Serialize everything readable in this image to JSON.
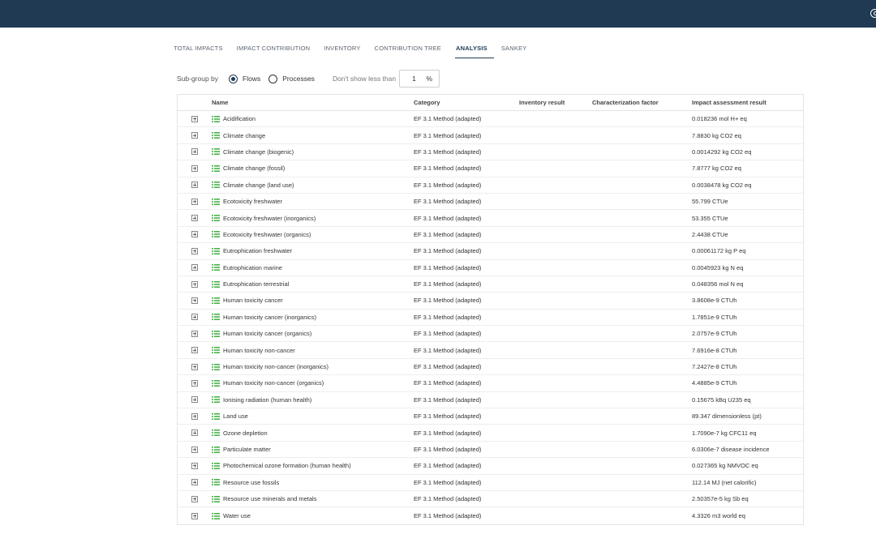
{
  "tabs": [
    {
      "label": "TOTAL IMPACTS",
      "active": false
    },
    {
      "label": "IMPACT CONTRIBUTION",
      "active": false
    },
    {
      "label": "INVENTORY",
      "active": false
    },
    {
      "label": "CONTRIBUTION TREE",
      "active": false
    },
    {
      "label": "ANALYSIS",
      "active": true
    },
    {
      "label": "SANKEY",
      "active": false
    }
  ],
  "controls": {
    "subgroup_label": "Sub-group by",
    "option_flows": "Flows",
    "option_processes": "Processes",
    "selected": "flows",
    "dont_show_label": "Don't show less than",
    "threshold_value": "1",
    "threshold_unit": "%"
  },
  "table": {
    "headers": {
      "name": "Name",
      "category": "Category",
      "inventory": "Inventory result",
      "characterization": "Characterization factor",
      "impact": "Impact assessment result"
    },
    "rows": [
      {
        "name": "Acidification",
        "category": "EF 3.1 Method (adapted)",
        "inventory": "",
        "characterization": "",
        "impact": "0.018236 mol H+ eq"
      },
      {
        "name": "Climate change",
        "category": "EF 3.1 Method (adapted)",
        "inventory": "",
        "characterization": "",
        "impact": "7.8830 kg CO2 eq"
      },
      {
        "name": "Climate change (biogenic)",
        "category": "EF 3.1 Method (adapted)",
        "inventory": "",
        "characterization": "",
        "impact": "0.0014292 kg CO2 eq"
      },
      {
        "name": "Climate change (fossil)",
        "category": "EF 3.1 Method (adapted)",
        "inventory": "",
        "characterization": "",
        "impact": "7.8777 kg CO2 eq"
      },
      {
        "name": "Climate change (land use)",
        "category": "EF 3.1 Method (adapted)",
        "inventory": "",
        "characterization": "",
        "impact": "0.0038478 kg CO2 eq"
      },
      {
        "name": "Ecotoxicity freshwater",
        "category": "EF 3.1 Method (adapted)",
        "inventory": "",
        "characterization": "",
        "impact": "55.799 CTUe"
      },
      {
        "name": "Ecotoxicity freshwater (inorganics)",
        "category": "EF 3.1 Method (adapted)",
        "inventory": "",
        "characterization": "",
        "impact": "53.355 CTUe"
      },
      {
        "name": "Ecotoxicity freshwater (organics)",
        "category": "EF 3.1 Method (adapted)",
        "inventory": "",
        "characterization": "",
        "impact": "2.4438 CTUe"
      },
      {
        "name": "Eutrophication freshwater",
        "category": "EF 3.1 Method (adapted)",
        "inventory": "",
        "characterization": "",
        "impact": "0.00061172 kg P eq"
      },
      {
        "name": "Eutrophication marine",
        "category": "EF 3.1 Method (adapted)",
        "inventory": "",
        "characterization": "",
        "impact": "0.0045923 kg N eq"
      },
      {
        "name": "Eutrophication terrestrial",
        "category": "EF 3.1 Method (adapted)",
        "inventory": "",
        "characterization": "",
        "impact": "0.048356 mol N eq"
      },
      {
        "name": "Human toxicity cancer",
        "category": "EF 3.1 Method (adapted)",
        "inventory": "",
        "characterization": "",
        "impact": "3.8608e-9 CTUh"
      },
      {
        "name": "Human toxicity cancer (inorganics)",
        "category": "EF 3.1 Method (adapted)",
        "inventory": "",
        "characterization": "",
        "impact": "1.7851e-9 CTUh"
      },
      {
        "name": "Human toxicity cancer (organics)",
        "category": "EF 3.1 Method (adapted)",
        "inventory": "",
        "characterization": "",
        "impact": "2.0757e-9 CTUh"
      },
      {
        "name": "Human toxicity non-cancer",
        "category": "EF 3.1 Method (adapted)",
        "inventory": "",
        "characterization": "",
        "impact": "7.6916e-8 CTUh"
      },
      {
        "name": "Human toxicity non-cancer (inorganics)",
        "category": "EF 3.1 Method (adapted)",
        "inventory": "",
        "characterization": "",
        "impact": "7.2427e-8 CTUh"
      },
      {
        "name": "Human toxicity non-cancer (organics)",
        "category": "EF 3.1 Method (adapted)",
        "inventory": "",
        "characterization": "",
        "impact": "4.4885e-9 CTUh"
      },
      {
        "name": "Ionising radiation (human health)",
        "category": "EF 3.1 Method (adapted)",
        "inventory": "",
        "characterization": "",
        "impact": "0.15675 kBq U235 eq"
      },
      {
        "name": "Land use",
        "category": "EF 3.1 Method (adapted)",
        "inventory": "",
        "characterization": "",
        "impact": "89.347 dimensionless (pt)"
      },
      {
        "name": "Ozone depletion",
        "category": "EF 3.1 Method (adapted)",
        "inventory": "",
        "characterization": "",
        "impact": "1.7090e-7 kg CFC11 eq"
      },
      {
        "name": "Particulate matter",
        "category": "EF 3.1 Method (adapted)",
        "inventory": "",
        "characterization": "",
        "impact": "6.0306e-7 disease incidence"
      },
      {
        "name": "Photochemical ozone formation (human health)",
        "category": "EF 3.1 Method (adapted)",
        "inventory": "",
        "characterization": "",
        "impact": "0.027365 kg NMVOC eq"
      },
      {
        "name": "Resource use fossils",
        "category": "EF 3.1 Method (adapted)",
        "inventory": "",
        "characterization": "",
        "impact": "112.14 MJ (net calorific)"
      },
      {
        "name": "Resource use minerals and metals",
        "category": "EF 3.1 Method (adapted)",
        "inventory": "",
        "characterization": "",
        "impact": "2.50357e-5 kg Sb eq"
      },
      {
        "name": "Water use",
        "category": "EF 3.1 Method (adapted)",
        "inventory": "",
        "characterization": "",
        "impact": "4.3326 m3 world eq"
      }
    ]
  },
  "icons": {
    "expand": "plus-square-icon",
    "row": "list-icon",
    "user": "user-icon"
  },
  "colors": {
    "header_bar": "#1f3a52",
    "list_icon": "#4caf50",
    "active_tab": "#1f3a52"
  }
}
